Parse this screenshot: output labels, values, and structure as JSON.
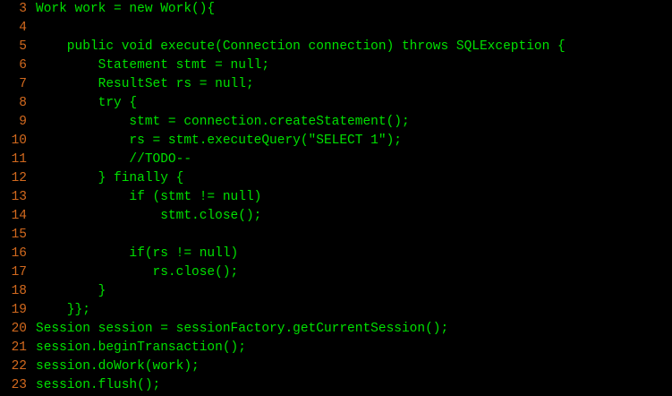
{
  "editor": {
    "colors": {
      "background": "#000000",
      "line_number": "#d2691e",
      "code_text": "#00e000"
    },
    "lines": [
      {
        "number": "3",
        "text": "Work work = new Work(){"
      },
      {
        "number": "4",
        "text": ""
      },
      {
        "number": "5",
        "text": "    public void execute(Connection connection) throws SQLException {"
      },
      {
        "number": "6",
        "text": "        Statement stmt = null;"
      },
      {
        "number": "7",
        "text": "        ResultSet rs = null;"
      },
      {
        "number": "8",
        "text": "        try {"
      },
      {
        "number": "9",
        "text": "            stmt = connection.createStatement();"
      },
      {
        "number": "10",
        "text": "            rs = stmt.executeQuery(\"SELECT 1\");"
      },
      {
        "number": "11",
        "text": "            //TODO--"
      },
      {
        "number": "12",
        "text": "        } finally {"
      },
      {
        "number": "13",
        "text": "            if (stmt != null)"
      },
      {
        "number": "14",
        "text": "                stmt.close();"
      },
      {
        "number": "15",
        "text": ""
      },
      {
        "number": "16",
        "text": "            if(rs != null)"
      },
      {
        "number": "17",
        "text": "               rs.close();"
      },
      {
        "number": "18",
        "text": "        }"
      },
      {
        "number": "19",
        "text": "    }};"
      },
      {
        "number": "20",
        "text": "Session session = sessionFactory.getCurrentSession();"
      },
      {
        "number": "21",
        "text": "session.beginTransaction();"
      },
      {
        "number": "22",
        "text": "session.doWork(work);"
      },
      {
        "number": "23",
        "text": "session.flush();"
      }
    ]
  }
}
